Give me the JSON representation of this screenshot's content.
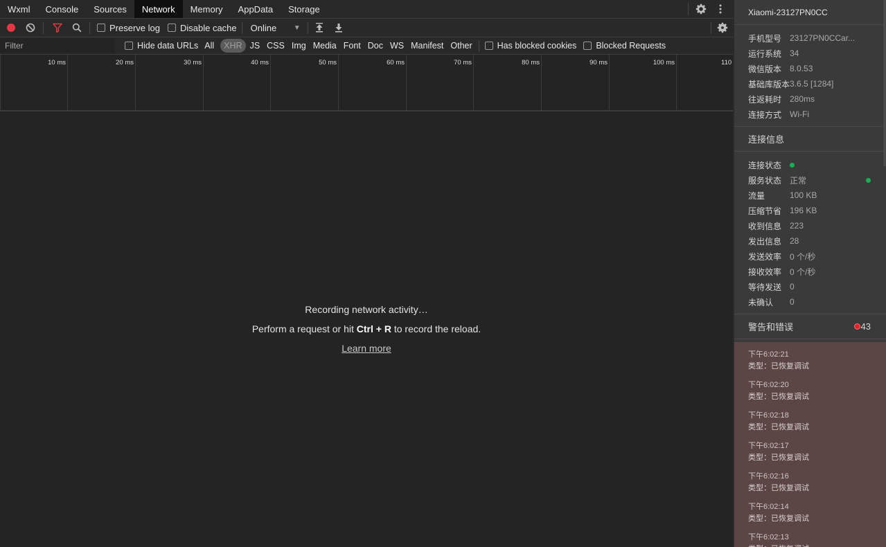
{
  "tabs": [
    "Wxml",
    "Console",
    "Sources",
    "Network",
    "Memory",
    "AppData",
    "Storage"
  ],
  "active_tab": "Network",
  "toolbar": {
    "preserve_log": "Preserve log",
    "disable_cache": "Disable cache",
    "throttle": "Online"
  },
  "filterbar": {
    "filter_placeholder": "Filter",
    "hide_data_urls": "Hide data URLs",
    "types": [
      "All",
      "XHR",
      "JS",
      "CSS",
      "Img",
      "Media",
      "Font",
      "Doc",
      "WS",
      "Manifest",
      "Other"
    ],
    "active_type": "XHR",
    "has_blocked_cookies": "Has blocked cookies",
    "blocked_requests": "Blocked Requests"
  },
  "timeline": {
    "ticks": [
      "10 ms",
      "20 ms",
      "30 ms",
      "40 ms",
      "50 ms",
      "60 ms",
      "70 ms",
      "80 ms",
      "90 ms",
      "100 ms",
      "110"
    ]
  },
  "empty_state": {
    "title": "Recording network activity…",
    "sub_before": "Perform a request or hit ",
    "sub_keys": "Ctrl + R",
    "sub_after": " to record the reload.",
    "learn_more": "Learn more"
  },
  "side": {
    "device": "Xiaomi-23127PN0CC",
    "device_info": [
      {
        "k": "手机型号",
        "v": "23127PN0CCar..."
      },
      {
        "k": "运行系统",
        "v": "34"
      },
      {
        "k": "微信版本",
        "v": "8.0.53"
      },
      {
        "k": "基础库版本",
        "v": "3.6.5 [1284]"
      },
      {
        "k": "往返耗时",
        "v": "280ms"
      },
      {
        "k": "连接方式",
        "v": "Wi-Fi"
      }
    ],
    "connection_title": "连接信息",
    "connection_status_label": "连接状态",
    "service_status_label": "服务状态",
    "service_status_value": "正常",
    "connection_info": [
      {
        "k": "流量",
        "v": "100 KB"
      },
      {
        "k": "压缩节省",
        "v": "196 KB"
      },
      {
        "k": "收到信息",
        "v": "223"
      },
      {
        "k": "发出信息",
        "v": "28"
      },
      {
        "k": "发送效率",
        "v": "0 个/秒"
      },
      {
        "k": "接收效率",
        "v": "0 个/秒"
      },
      {
        "k": "等待发送",
        "v": "0"
      },
      {
        "k": "未确认",
        "v": "0"
      }
    ],
    "warnings_title": "警告和错误",
    "warnings_count": "43",
    "logs": [
      {
        "time": "下午6:02:21",
        "type": "类型：已恢复调试"
      },
      {
        "time": "下午6:02:20",
        "type": "类型：已恢复调试"
      },
      {
        "time": "下午6:02:18",
        "type": "类型：已恢复调试"
      },
      {
        "time": "下午6:02:17",
        "type": "类型：已恢复调试"
      },
      {
        "time": "下午6:02:16",
        "type": "类型：已恢复调试"
      },
      {
        "time": "下午6:02:14",
        "type": "类型：已恢复调试"
      },
      {
        "time": "下午6:02:13",
        "type": "类型：已恢复调试"
      }
    ]
  },
  "colors": {
    "record_red": "#e5373f",
    "filter_red": "#e5373f",
    "status_green": "#1aad56",
    "log_bg": "#5b4645"
  },
  "icons": {
    "record": "record-icon",
    "clear": "clear-icon",
    "filter": "filter-icon",
    "search": "search-icon",
    "import": "import-icon",
    "export": "export-icon",
    "settings": "gear-icon",
    "more": "more-vertical-icon"
  }
}
